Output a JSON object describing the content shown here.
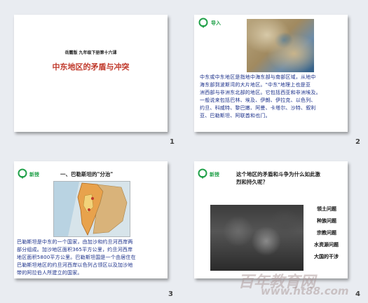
{
  "slides": [
    {
      "number": "1",
      "subtitle": "岳麓版 九年级下册第十六课",
      "title": "中东地区的矛盾与冲突"
    },
    {
      "number": "2",
      "section_label": "导入",
      "body_lines": [
        "中东或中东地区是指地中海东部与南部区域，从地中",
        "海东部到波斯湾的大片地区。\"中东\"地理上也是亚",
        "洲西部与非洲东北部的地区。它包括西亚和非洲埃及。",
        "一般说来包括巴林、埃及、伊朗、伊拉克、以色列、",
        "约旦、科威特、黎巴嫩、阿曼、卡塔尔、沙特、叙利",
        "亚、巴勒斯坦、阿联酋和也门。"
      ]
    },
    {
      "number": "3",
      "section_label": "新授",
      "heading": "一、巴勒斯坦的\"分治\"",
      "body_lines": [
        "巴勒斯坦是中东的一个国家，由加沙和约旦河西岸两",
        "部分组成。加沙地区面积365平方公里，约旦河西岸",
        "地区面积5800平方公里。巴勒斯坦国是一个由居住在",
        "巴勒斯坦地区的约旦河西岸以色列占领区以及加沙地",
        "带的阿拉伯人所建立的国家。"
      ]
    },
    {
      "number": "4",
      "section_label": "新授",
      "question_lines": [
        "这个地区的矛盾和斗争为什么如此激",
        "烈和持久呢？"
      ],
      "topics": [
        "领土问题",
        "种族问题",
        "宗教问题",
        "水资源问题",
        "大国的干涉"
      ]
    }
  ],
  "watermark": {
    "line1": "百年教育网",
    "line2": "www.ht88.com"
  },
  "colors": {
    "background": "#e9ecf1",
    "title_red": "#c0392b",
    "section_green": "#22a14a",
    "body_blue": "#1a2f8a"
  }
}
